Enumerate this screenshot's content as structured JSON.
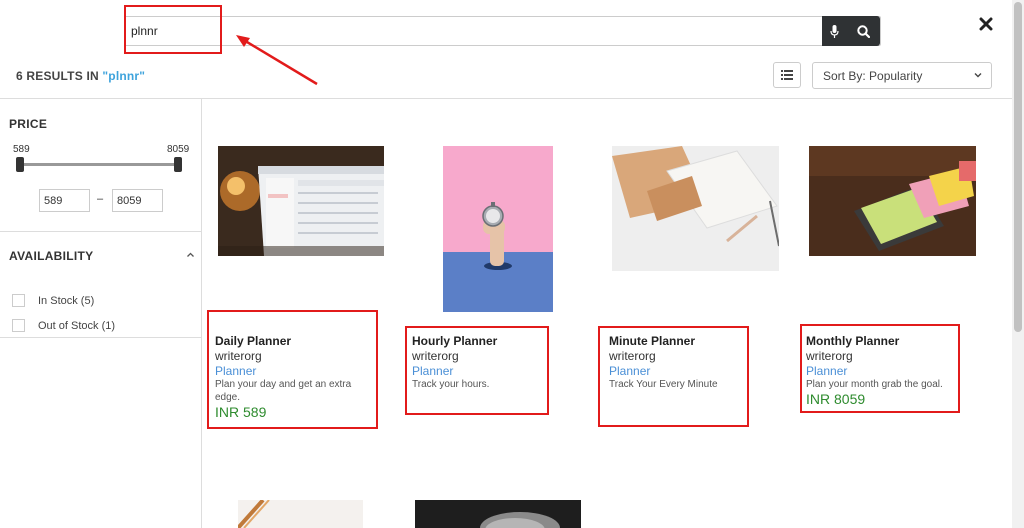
{
  "search": {
    "value": "plnnr"
  },
  "results": {
    "count_text": "6 RESULTS IN",
    "query_text": "\"plnnr\""
  },
  "sort": {
    "label": "Sort By: Popularity"
  },
  "filters": {
    "price": {
      "title": "PRICE",
      "min_label": "589",
      "max_label": "8059",
      "min_value": "589",
      "max_value": "8059",
      "dash": "–"
    },
    "availability": {
      "title": "AVAILABILITY",
      "options": [
        "In Stock (5)",
        "Out of Stock (1)"
      ]
    }
  },
  "products": [
    {
      "name": "Daily Planner",
      "vendor": "writerorg",
      "category": "Planner",
      "desc_line1": "Plan your day and get an extra",
      "desc_line2": "edge.",
      "price": "INR 589"
    },
    {
      "name": "Hourly Planner",
      "vendor": "writerorg",
      "category": "Planner",
      "desc_line1": "Track your hours.",
      "desc_line2": "",
      "price": ""
    },
    {
      "name": "Minute Planner",
      "vendor": "writerorg",
      "category": "Planner",
      "desc_line1": "Track Your Every Minute",
      "desc_line2": "",
      "price": ""
    },
    {
      "name": "Monthly Planner",
      "vendor": "writerorg",
      "category": "Planner",
      "desc_line1": "Plan your month grab the goal.",
      "desc_line2": "",
      "price": "INR 8059"
    }
  ],
  "icons": {
    "mic": "microphone-icon",
    "search": "search-icon",
    "close": "close-icon",
    "list": "list-view-icon",
    "chevron": "chevron-down-icon",
    "caret": "caret-up-icon"
  },
  "colors": {
    "accent_link": "#4a8fd6",
    "query_blue": "#3ea3dc",
    "price_green": "#2e8b2e",
    "annotation_red": "#e21b1b",
    "search_btn_bg": "#2f3234"
  }
}
